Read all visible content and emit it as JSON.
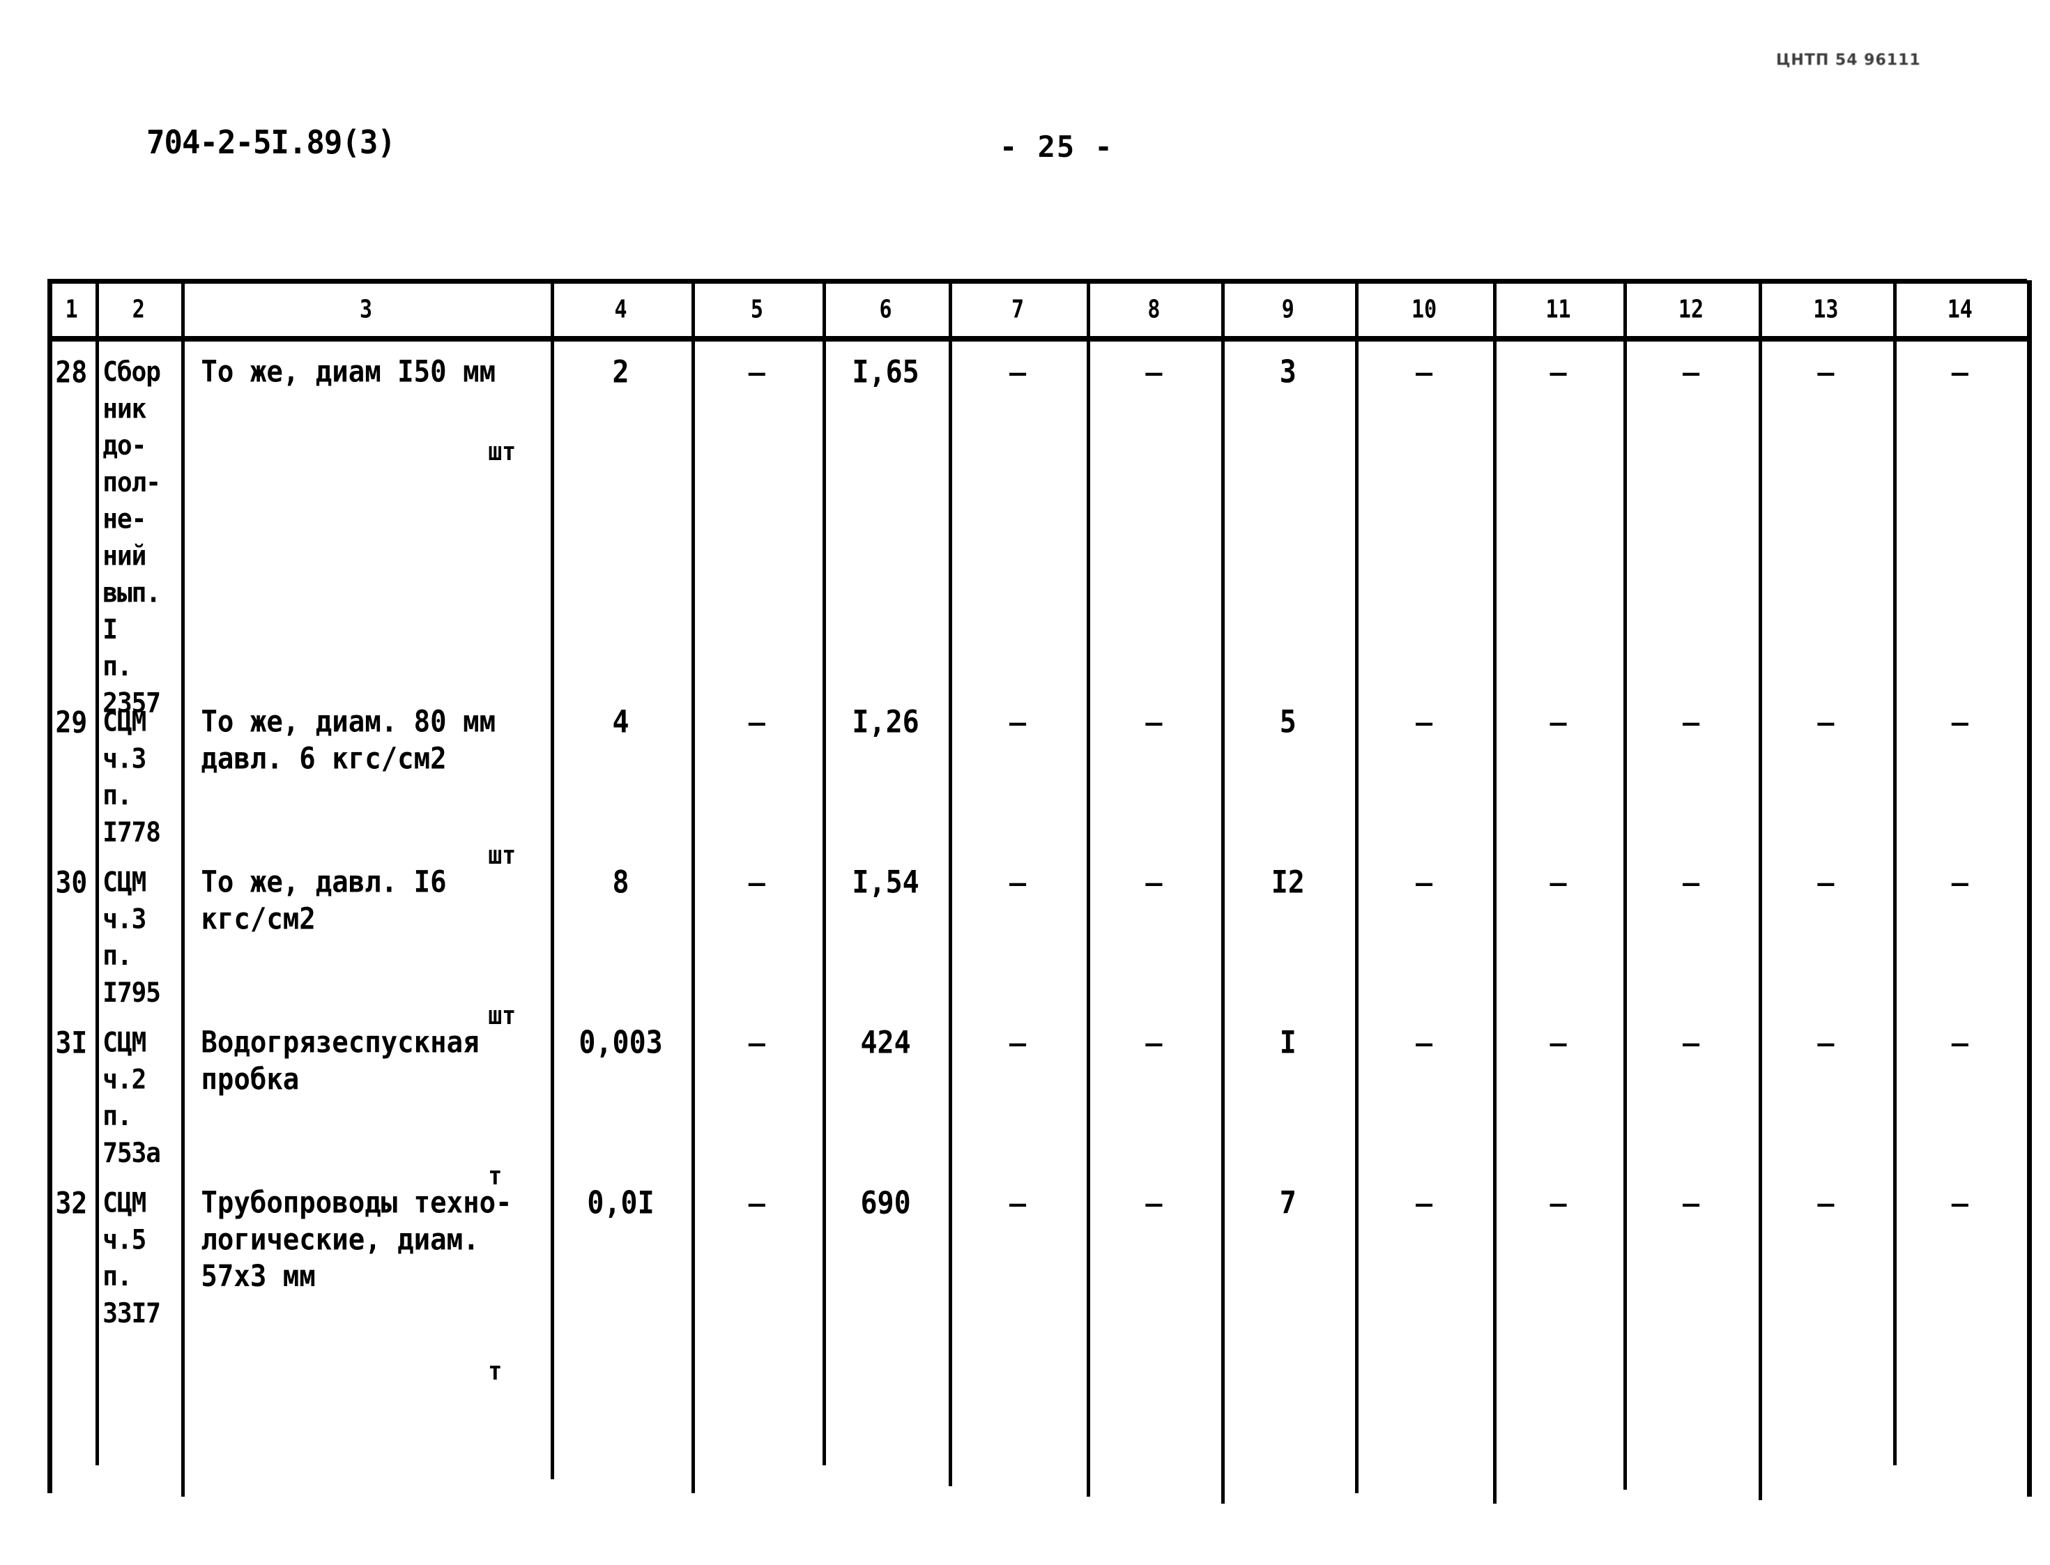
{
  "header": {
    "stamp": "ЦНТП 54 96111",
    "doc_number": "704-2-5I.89(3)",
    "page_number": "- 25 -"
  },
  "table": {
    "column_headers": [
      "1",
      "2",
      "3",
      "4",
      "5",
      "6",
      "7",
      "8",
      "9",
      "10",
      "11",
      "12",
      "13",
      "14"
    ],
    "rows": [
      {
        "num": "28",
        "code": "Сбор\nник\nдо-\nпол-\nне-\nний\nвып.\nI\nп.\n2357",
        "description": "То же, диам  I50 мм",
        "unit": "шт",
        "col4": "2",
        "col5": "-",
        "col6": "I,65",
        "col7": "-",
        "col8": "-",
        "col9": "3",
        "col10": "-",
        "col11": "-",
        "col12": "-",
        "col13": "-",
        "col14": "-"
      },
      {
        "num": "29",
        "code": "СЦМ\nч.3\nп.\nI778",
        "description": "То же, диам. 80 мм\nдавл. 6 кгс/см2",
        "unit": "шт",
        "col4": "4",
        "col5": "-",
        "col6": "I,26",
        "col7": "-",
        "col8": "-",
        "col9": "5",
        "col10": "-",
        "col11": "-",
        "col12": "-",
        "col13": "-",
        "col14": "-"
      },
      {
        "num": "30",
        "code": "СЦМ\nч.3\nп.\nI795",
        "description": "То же, давл. I6\nкгс/см2",
        "unit": "шт",
        "col4": "8",
        "col5": "-",
        "col6": "I,54",
        "col7": "-",
        "col8": "-",
        "col9": "I2",
        "col10": "-",
        "col11": "-",
        "col12": "-",
        "col13": "-",
        "col14": "-"
      },
      {
        "num": "3I",
        "code": "СЦМ\nч.2\nп.\n753а",
        "description": "Водогрязеспускная\nпробка",
        "unit": "т",
        "col4": "0,003",
        "col5": "-",
        "col6": "424",
        "col7": "-",
        "col8": "-",
        "col9": "I",
        "col10": "-",
        "col11": "-",
        "col12": "-",
        "col13": "-",
        "col14": "-"
      },
      {
        "num": "32",
        "code": "СЦМ\nч.5\nп.\n33I7",
        "description": "Трубопроводы техно-\nлогические, диам.\n57х3 мм",
        "unit": "т",
        "col4": "0,0I",
        "col5": "-",
        "col6": "690",
        "col7": "-",
        "col8": "-",
        "col9": "7",
        "col10": "-",
        "col11": "-",
        "col12": "-",
        "col13": "-",
        "col14": "-"
      }
    ]
  }
}
